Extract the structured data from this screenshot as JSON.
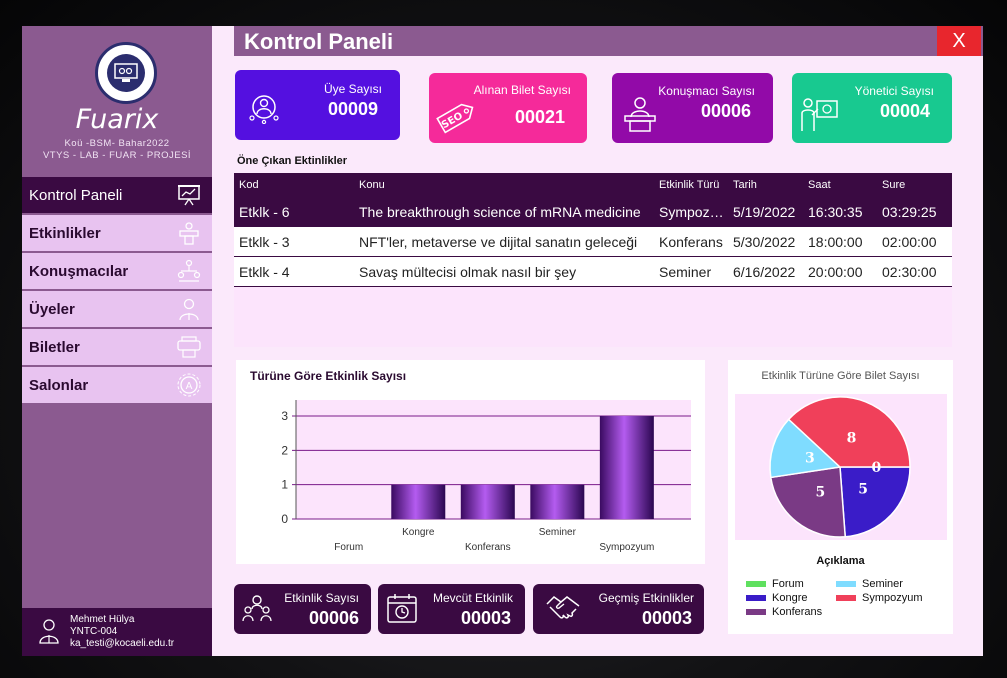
{
  "app": {
    "brand": "Fuarix",
    "subtitle1": "Koü -BSM- Bahar2022",
    "subtitle2": "VTYS - LAB - FUAR - PROJESİ"
  },
  "header": {
    "title": "Kontrol Paneli",
    "close": "X"
  },
  "nav": {
    "items": [
      {
        "label": "Kontrol Paneli",
        "icon": "presentation-chart-icon"
      },
      {
        "label": "Etkinlikler",
        "icon": "podium-icon"
      },
      {
        "label": "Konuşmacılar",
        "icon": "network-people-icon"
      },
      {
        "label": "Üyeler",
        "icon": "user-icon"
      },
      {
        "label": "Biletler",
        "icon": "ticket-printer-icon"
      },
      {
        "label": "Salonlar",
        "icon": "gear-badge-icon"
      }
    ]
  },
  "user": {
    "name": "Mehmet Hülya",
    "code": "YNTC-004",
    "email": "ka_testi@kocaeli.edu.tr"
  },
  "stats": {
    "uye": {
      "label": "Üye Sayısı",
      "value": "00009",
      "color": "#5410e0"
    },
    "bilet": {
      "label": "Alınan Bilet Sayısı",
      "value": "00021",
      "color": "#f52a9a"
    },
    "konusmaci": {
      "label": "Konuşmacı Sayısı",
      "value": "00006",
      "color": "#920aa8"
    },
    "yonetici": {
      "label": "Yönetici Sayısı",
      "value": "00004",
      "color": "#18c990"
    }
  },
  "table": {
    "title": "Öne Çıkan Ektinlikler",
    "headers": [
      "Kod",
      "Konu",
      "Etkinlik Türü",
      "Tarih",
      "Saat",
      "Sure"
    ],
    "rows": [
      [
        "Etklk - 6",
        "The breakthrough science of mRNA medicine",
        "Sympozyum",
        "5/19/2022",
        "16:30:35",
        "03:29:25"
      ],
      [
        "Etklk - 3",
        "NFT'ler, metaverse ve dijital sanatın geleceği",
        "Konferans",
        "5/30/2022",
        "18:00:00",
        "02:00:00"
      ],
      [
        "Etklk - 4",
        "Savaş mültecisi olmak nasıl bir şey",
        "Seminer",
        "6/16/2022",
        "20:00:00",
        "02:30:00"
      ]
    ]
  },
  "bottom_stats": {
    "etkinlik": {
      "label": "Etkinlik Sayısı",
      "value": "00006"
    },
    "mevcut": {
      "label": "Mevcüt Etkinlik",
      "value": "00003"
    },
    "gecmis": {
      "label": "Geçmiş Etkinlikler",
      "value": "00003"
    }
  },
  "colors": {
    "dark_purple": "#3a0a42",
    "sidebar": "#8b5a90",
    "card_dark": "#3a0a42"
  },
  "chart_data": [
    {
      "type": "bar",
      "title": "Türüne Göre Etkinlik Sayısı",
      "categories": [
        "Forum",
        "Kongre",
        "Konferans",
        "Seminer",
        "Sympozyum"
      ],
      "values": [
        0,
        1,
        1,
        1,
        3
      ],
      "ylim": [
        0,
        3
      ],
      "yticks": [
        "0",
        "1",
        "2",
        "3"
      ],
      "grid": true
    },
    {
      "type": "pie",
      "title": "Etkinlik Türüne Göre Bilet Sayısı",
      "legend_title": "Açıklama",
      "slices": [
        {
          "label": "Forum",
          "value": 0,
          "color": "#5fe05f"
        },
        {
          "label": "Kongre",
          "value": 5,
          "color": "#3a1cc8"
        },
        {
          "label": "Konferans",
          "value": 5,
          "color": "#7a3a85"
        },
        {
          "label": "Seminer",
          "value": 3,
          "color": "#7fdcff"
        },
        {
          "label": "Sympozyum",
          "value": 8,
          "color": "#f0405a"
        }
      ]
    }
  ]
}
